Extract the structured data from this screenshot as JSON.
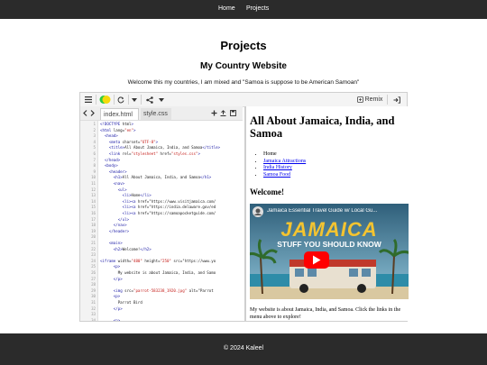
{
  "nav": {
    "home": "Home",
    "projects": "Projects"
  },
  "page": {
    "title": "Projects",
    "project_title": "My Country Website",
    "description": "Welcome this my countries, I am mixed and \"Samoa is suppose to be American Samoan\""
  },
  "toolbar": {
    "menu_icon": "menu-icon",
    "logo_icon": "glitch-logo-icon",
    "reload_icon": "reload-icon",
    "dropdown_icon": "chevron-down-icon",
    "share_icon": "share-icon",
    "remix_label": "Remix",
    "signin_icon": "sign-in-icon"
  },
  "editor": {
    "tabs": [
      "index.html",
      "style.css"
    ],
    "lines": [
      {
        "n": "1",
        "t": "<!DOCTYPE html>"
      },
      {
        "n": "2",
        "t": "<html lang=\"en\">"
      },
      {
        "n": "3",
        "t": "  <head>"
      },
      {
        "n": "4",
        "t": "    <meta charset=\"UTF-8\">"
      },
      {
        "n": "5",
        "t": "    <title>All About Jamaica, India, and Samoa</title>"
      },
      {
        "n": "6",
        "t": "    <link rel=\"stylesheet\" href=\"styles.css\">"
      },
      {
        "n": "7",
        "t": "  </head>"
      },
      {
        "n": "8",
        "t": "  <body>"
      },
      {
        "n": "9",
        "t": "    <header>"
      },
      {
        "n": "10",
        "t": "      <h1>All About Jamaica, India, and Samoa</h1>"
      },
      {
        "n": "11",
        "t": "      <nav>"
      },
      {
        "n": "12",
        "t": "        <ul>"
      },
      {
        "n": "13",
        "t": "          <li>Home</li>"
      },
      {
        "n": "14",
        "t": "          <li><a href=\"https://www.visitjamaica.com/"
      },
      {
        "n": "15",
        "t": "          <li><a href=\"https://india.delaware.gov/ed"
      },
      {
        "n": "16",
        "t": "          <li><a href=\"https://samoapocketguide.com/"
      },
      {
        "n": "17",
        "t": "        </ul>"
      },
      {
        "n": "18",
        "t": "      </nav>"
      },
      {
        "n": "19",
        "t": "    </header>"
      },
      {
        "n": "20",
        "t": ""
      },
      {
        "n": "21",
        "t": "    <main>"
      },
      {
        "n": "22",
        "t": "      <h2>Welcome!</h2>"
      },
      {
        "n": "23",
        "t": ""
      },
      {
        "n": "24",
        "t": "<iframe width=\"480\" height=\"250\" src=\"https://www.yo"
      },
      {
        "n": "25",
        "t": "      <p>"
      },
      {
        "n": "26",
        "t": "        My website is about Jamaica, India, and Samo"
      },
      {
        "n": "27",
        "t": "      </p>"
      },
      {
        "n": "28",
        "t": ""
      },
      {
        "n": "29",
        "t": "      <img src=\"parrot-583238_1920.jpg\" alt=\"Parrot"
      },
      {
        "n": "30",
        "t": "      <p>"
      },
      {
        "n": "31",
        "t": "        Parrot Bird"
      },
      {
        "n": "32",
        "t": "      </p>"
      },
      {
        "n": "33",
        "t": ""
      },
      {
        "n": "34",
        "t": "      <p>"
      },
      {
        "n": "35",
        "t": "        <a href=\"http://www.visitjamaica.com/\" targe"
      },
      {
        "n": "36",
        "t": "      <p>"
      },
      {
        "n": "37",
        "t": "        <a href=\"http://www.india.com/\" target=\"_bla"
      }
    ]
  },
  "preview": {
    "h1": "All About Jamaica, India, and Samoa",
    "nav": {
      "home": "Home",
      "links": [
        "Jamaica Attractions",
        "India History",
        "Samoa Food"
      ]
    },
    "h2": "Welcome!",
    "video_title": "Jamaica Essential Travel Guide w/ Local Gu...",
    "video_big_title": "JAMAICA",
    "video_subtitle": "STUFF YOU SHOULD KNOW",
    "body": "My website is about Jamaica, India, and Samoa. Click the links in the menu above to explore!"
  },
  "footer": {
    "text": "© 2024 Kaleel"
  },
  "colors": {
    "nav_bg": "#2b2b2b",
    "youtube_red": "#ff0000",
    "link_blue": "#0000ee"
  }
}
